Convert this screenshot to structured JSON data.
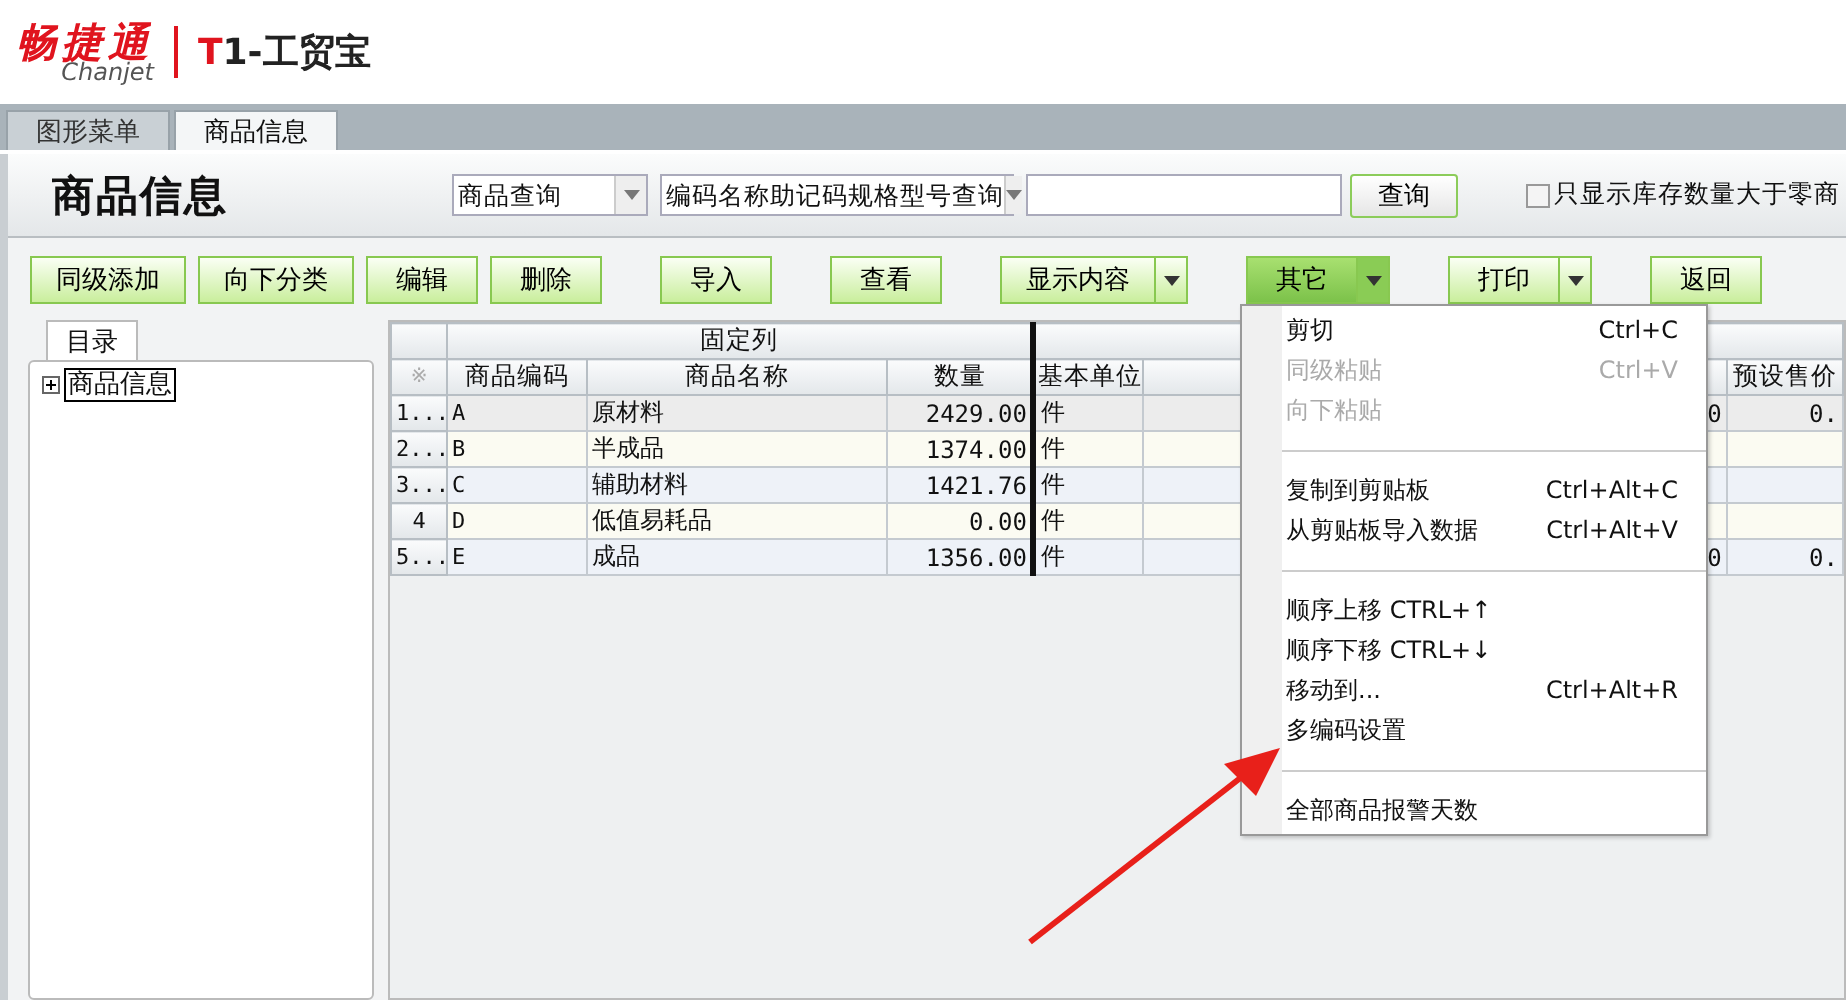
{
  "logo": {
    "brand": "畅捷通",
    "sub": "Chanjet",
    "product_mark": "T",
    "product": "1-工贸宝"
  },
  "tabs": [
    {
      "label": "图形菜单",
      "selected": false
    },
    {
      "label": "商品信息",
      "selected": true
    }
  ],
  "page_title": "商品信息",
  "search": {
    "scope": "商品查询",
    "mode": "编码名称助记码规格型号查询",
    "query_button": "查询",
    "stock_filter": {
      "label": "只显示库存数量大于零商",
      "checked": false
    }
  },
  "toolbar": [
    {
      "label": "同级添加",
      "kind": "plain",
      "active": false
    },
    {
      "label": "向下分类",
      "kind": "plain",
      "active": false
    },
    {
      "label": "编辑",
      "kind": "plain",
      "active": false
    },
    {
      "label": "删除",
      "kind": "plain",
      "active": false
    },
    {
      "label": "导入",
      "kind": "plain",
      "active": false
    },
    {
      "label": "查看",
      "kind": "plain",
      "active": false
    },
    {
      "label": "显示内容",
      "kind": "split",
      "active": false
    },
    {
      "label": "其它",
      "kind": "split",
      "active": true
    },
    {
      "label": "打印",
      "kind": "split",
      "active": false
    },
    {
      "label": "返回",
      "kind": "plain",
      "active": false
    }
  ],
  "tree": {
    "tab": "目录",
    "items": [
      {
        "label": "商品信息",
        "expanded": false
      }
    ]
  },
  "table": {
    "group_header": "固定列",
    "corner": "※",
    "columns": [
      "商品编码",
      "商品名称",
      "数量",
      "基本单位",
      "",
      "",
      "预设售价"
    ],
    "rows": [
      {
        "num": "1...",
        "selected": true,
        "cells": [
          "A",
          "原材料",
          "2429.00",
          "件",
          "",
          "0",
          "0."
        ]
      },
      {
        "num": "2...",
        "selected": false,
        "cells": [
          "B",
          "半成品",
          "1374.00",
          "件",
          "",
          "",
          ""
        ]
      },
      {
        "num": "3...",
        "selected": false,
        "cells": [
          "C",
          "辅助材料",
          "1421.76",
          "件",
          "",
          "",
          ""
        ]
      },
      {
        "num": "4",
        "selected": false,
        "cells": [
          "D",
          "低值易耗品",
          "0.00",
          "件",
          "",
          "",
          ""
        ]
      },
      {
        "num": "5...",
        "selected": false,
        "cells": [
          "E",
          "成品",
          "1356.00",
          "件",
          "",
          "0",
          "0."
        ]
      }
    ]
  },
  "menu": [
    {
      "kind": "item",
      "label": "剪切",
      "shortcut": "Ctrl+C",
      "disabled": false
    },
    {
      "kind": "item",
      "label": "同级粘贴",
      "shortcut": "Ctrl+V",
      "disabled": true
    },
    {
      "kind": "item",
      "label": "向下粘贴",
      "disabled": true
    },
    {
      "kind": "separator"
    },
    {
      "kind": "item",
      "label": "复制到剪贴板",
      "shortcut": "Ctrl+Alt+C",
      "disabled": false
    },
    {
      "kind": "item",
      "label": "从剪贴板导入数据",
      "shortcut": "Ctrl+Alt+V",
      "disabled": false
    },
    {
      "kind": "separator"
    },
    {
      "kind": "item",
      "label": "顺序上移 CTRL+↑",
      "disabled": false
    },
    {
      "kind": "item",
      "label": "顺序下移 CTRL+↓",
      "disabled": false
    },
    {
      "kind": "item",
      "label": "移动到...",
      "shortcut": "Ctrl+Alt+R",
      "disabled": false
    },
    {
      "kind": "item",
      "label": "多编码设置",
      "disabled": false
    },
    {
      "kind": "separator"
    },
    {
      "kind": "item",
      "label": "全部商品报警天数",
      "disabled": false
    }
  ]
}
